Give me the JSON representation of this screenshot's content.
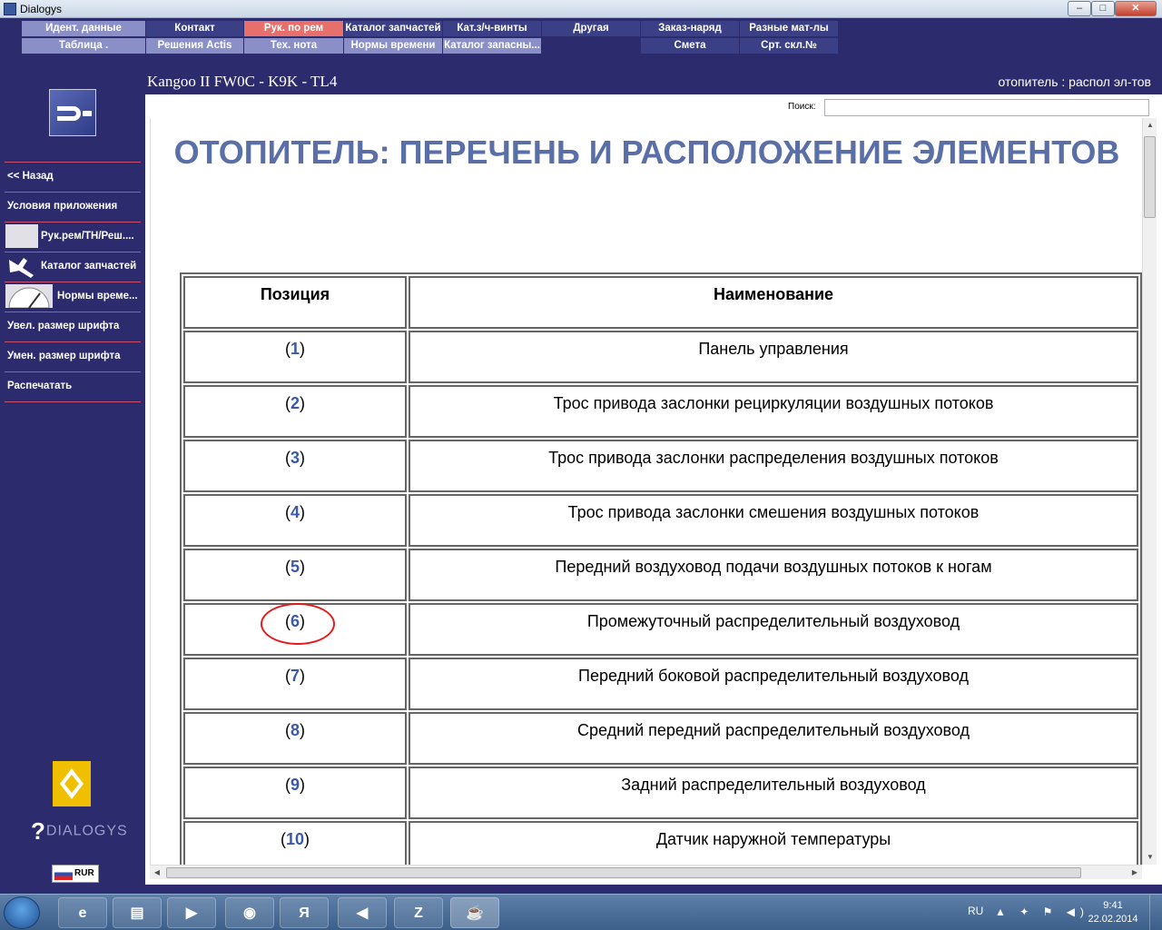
{
  "window": {
    "title": "Dialogys",
    "min_label": "–",
    "max_label": "□",
    "close_label": "✕"
  },
  "menu": {
    "row1": [
      "Идент. данные",
      "Контакт",
      "Рук. по рем",
      "Каталог запчастей",
      "Кат.з/ч-винты",
      "Другая",
      "Заказ-наряд",
      "Разные мат-лы"
    ],
    "row2": [
      "Таблица .",
      "Решения Actis",
      "Тех. нота",
      "Нормы времени",
      "Каталог запасны...",
      "Смета",
      "Срт. скл.№"
    ]
  },
  "sidebar": {
    "items": [
      "<< Назад",
      "Условия приложения",
      "Рук.рем/ТН/Реш....",
      "Каталог запчастей",
      "Нормы време...",
      "Увел. размер шрифта",
      "Умен. размер шрифта",
      "Распечатать"
    ],
    "brand": "DIALOGYS",
    "brand_mark": "?",
    "currency": "RUR"
  },
  "header": {
    "car": "Kangoo II FW0C - K9K - TL4",
    "section": "отопитель : распол эл-тов"
  },
  "search": {
    "label": "Поиск:",
    "value": ""
  },
  "document": {
    "title": "ОТОПИТЕЛЬ: ПЕРЕЧЕНЬ И РАСПОЛОЖЕНИЕ ЭЛЕМЕНТОВ",
    "columns": [
      "Позиция",
      "Наименование"
    ],
    "rows": [
      {
        "pos": "1",
        "name": "Панель управления"
      },
      {
        "pos": "2",
        "name": "Трос привода заслонки рециркуляции воздушных потоков"
      },
      {
        "pos": "3",
        "name": "Трос привода заслонки распределения воздушных потоков"
      },
      {
        "pos": "4",
        "name": "Трос привода заслонки смешения воздушных потоков"
      },
      {
        "pos": "5",
        "name": "Передний воздуховод подачи воздушных потоков к ногам"
      },
      {
        "pos": "6",
        "name": "Промежуточный распределительный воздуховод"
      },
      {
        "pos": "7",
        "name": "Передний боковой распределительный воздуховод"
      },
      {
        "pos": "8",
        "name": "Средний передний распределительный воздуховод"
      },
      {
        "pos": "9",
        "name": "Задний распределительный воздуховод"
      },
      {
        "pos": "10",
        "name": "Датчик наружной температуры"
      }
    ],
    "highlighted_pos": "6"
  },
  "taskbar": {
    "apps": [
      "e",
      "▤",
      "▶",
      "◉",
      "Я",
      "◀",
      "Z",
      "☕"
    ],
    "language": "RU",
    "time": "9:41",
    "date": "22.02.2014"
  },
  "colors": {
    "background": "#2b2b6e",
    "menu_light": "#8a8fc8",
    "menu_active": "#e8706c",
    "title_text": "#5a6fa8",
    "separator": "#c9506a",
    "annotation_circle": "#e31b1b"
  }
}
